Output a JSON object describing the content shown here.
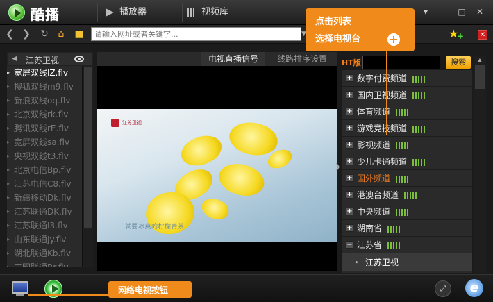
{
  "titlebar": {
    "app_name": "酷播",
    "tabs": [
      {
        "label": "播放器"
      },
      {
        "label": "视频库"
      }
    ]
  },
  "address": {
    "placeholder": "请输入网址或者关键字..."
  },
  "left_panel": {
    "title": "江苏卫视",
    "items": [
      {
        "label": "宽屏双线lZ.flv",
        "active": true
      },
      {
        "label": "搜狐双线m9.flv"
      },
      {
        "label": "新浪双线oq.flv"
      },
      {
        "label": "北京双线rk.flv"
      },
      {
        "label": "腾讯双线rE.flv"
      },
      {
        "label": "宽屏双线sa.flv"
      },
      {
        "label": "央视双线t3.flv"
      },
      {
        "label": "北京电信Bp.flv"
      },
      {
        "label": "江苏电信C8.flv"
      },
      {
        "label": "新疆移动Dk.flv"
      },
      {
        "label": "江苏联通DK.flv"
      },
      {
        "label": "江苏联通I3.flv"
      },
      {
        "label": "山东联通Jy.flv"
      },
      {
        "label": "湖北联通Kb.flv"
      },
      {
        "label": "三网联通Rr.flv"
      }
    ]
  },
  "center": {
    "tabs": [
      {
        "label": "电视直播信号"
      },
      {
        "label": "线路排序设置"
      }
    ],
    "video": {
      "channel_logo_text": "江苏卫视",
      "caption": "就要冰爽的柠檬青茶"
    }
  },
  "right_panel": {
    "ht_label": "HT版",
    "search_button": "搜索",
    "categories": [
      {
        "label": "数字付费频道",
        "state": "collapsed",
        "sign": "+"
      },
      {
        "label": "国内卫视频道",
        "state": "collapsed",
        "sign": "+"
      },
      {
        "label": "体育频道",
        "state": "collapsed",
        "sign": "+"
      },
      {
        "label": "游戏竞技频道",
        "state": "collapsed",
        "sign": "+"
      },
      {
        "label": "影视频道",
        "state": "collapsed",
        "sign": "+"
      },
      {
        "label": "少儿卡通频道",
        "state": "collapsed",
        "sign": "+"
      },
      {
        "label": "国外频道",
        "state": "collapsed",
        "sign": "+",
        "hot": true
      },
      {
        "label": "港澳台频道",
        "state": "collapsed",
        "sign": "+"
      },
      {
        "label": "中央频道",
        "state": "collapsed",
        "sign": "+"
      },
      {
        "label": "湖南省",
        "state": "collapsed",
        "sign": "+"
      },
      {
        "label": "江苏省",
        "state": "expanded",
        "sign": "−"
      }
    ],
    "sub_item": "江苏卫视"
  },
  "annotations": {
    "top_line1": "点击列表",
    "top_line2": "选择电视台",
    "bottom": "网络电视按钮"
  },
  "colors": {
    "accent_orange": "#f08a1a",
    "hot_text": "#f07a20",
    "signal_green": "#7bbf3a"
  }
}
